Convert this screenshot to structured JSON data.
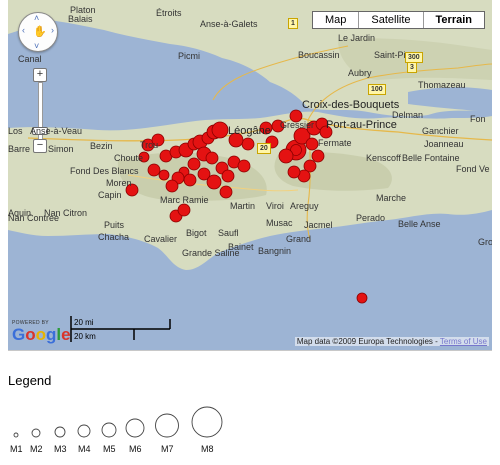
{
  "map": {
    "map_types": [
      {
        "label": "Map",
        "active": false
      },
      {
        "label": "Satellite",
        "active": false
      },
      {
        "label": "Terrain",
        "active": true
      }
    ],
    "controls": {
      "zoom_in": "+",
      "zoom_out": "−",
      "pan_arrows": [
        "‹",
        "›",
        "˄",
        "˅"
      ],
      "pan_hand": "✋"
    },
    "places": [
      {
        "name": "Platon",
        "key": "p1"
      },
      {
        "name": "Balais",
        "key": "p2"
      },
      {
        "name": "Étroits",
        "key": "p3"
      },
      {
        "name": "Anse-à-Galets",
        "key": "p4"
      },
      {
        "name": "Le Jardin",
        "key": "p5"
      },
      {
        "name": "Boucassin",
        "key": "p6"
      },
      {
        "name": "Saint-Pierre",
        "key": "p7"
      },
      {
        "name": "Picmi",
        "key": "p8"
      },
      {
        "name": "Aubry",
        "key": "p9"
      },
      {
        "name": "Thomazeau",
        "key": "p10"
      },
      {
        "name": "Canal",
        "key": "p11"
      },
      {
        "name": "Croix-des-Bouquets",
        "key": "p12"
      },
      {
        "name": "Delman",
        "key": "p13"
      },
      {
        "name": "Léogâne",
        "key": "p14"
      },
      {
        "name": "Gressier",
        "key": "p15"
      },
      {
        "name": "Port-au-Prince",
        "key": "p16"
      },
      {
        "name": "Ganchier",
        "key": "p17"
      },
      {
        "name": "Fon",
        "key": "p18"
      },
      {
        "name": "Los",
        "key": "p19"
      },
      {
        "name": "Anse-à-Veau",
        "key": "p20"
      },
      {
        "name": "Barre",
        "key": "p21"
      },
      {
        "name": "Simon",
        "key": "p22"
      },
      {
        "name": "Bezin",
        "key": "p23"
      },
      {
        "name": "Trou",
        "key": "p24"
      },
      {
        "name": "Fermate",
        "key": "p25"
      },
      {
        "name": "Joanneau",
        "key": "p26"
      },
      {
        "name": "Choute",
        "key": "p27"
      },
      {
        "name": "Kenscoff",
        "key": "p28"
      },
      {
        "name": "Belle Fontaine",
        "key": "p29"
      },
      {
        "name": "Fond Ve",
        "key": "p30"
      },
      {
        "name": "Fond Des Blancs",
        "key": "p31"
      },
      {
        "name": "Moren",
        "key": "p32"
      },
      {
        "name": "Capin",
        "key": "p33"
      },
      {
        "name": "Nan Contree",
        "key": "p34"
      },
      {
        "name": "Marche",
        "key": "p35"
      },
      {
        "name": "Martin",
        "key": "p36"
      },
      {
        "name": "Viroi",
        "key": "p37"
      },
      {
        "name": "Areguy",
        "key": "p38"
      },
      {
        "name": "Aquin",
        "key": "p39"
      },
      {
        "name": "Nan Citron",
        "key": "p40"
      },
      {
        "name": "Marc Ramie",
        "key": "p41"
      },
      {
        "name": "Puits",
        "key": "p42"
      },
      {
        "name": "Chacha",
        "key": "p43"
      },
      {
        "name": "Cavalier",
        "key": "p44"
      },
      {
        "name": "Bigot",
        "key": "p45"
      },
      {
        "name": "Saufl",
        "key": "p46"
      },
      {
        "name": "Musac",
        "key": "p47"
      },
      {
        "name": "Jacmel",
        "key": "p48"
      },
      {
        "name": "Perado",
        "key": "p49"
      },
      {
        "name": "Belle Anse",
        "key": "p50"
      },
      {
        "name": "Grand",
        "key": "p51"
      },
      {
        "name": "Gros",
        "key": "p52"
      },
      {
        "name": "Bainet",
        "key": "p53"
      },
      {
        "name": "Bangnin",
        "key": "p54"
      },
      {
        "name": "Grande Saline",
        "key": "p55"
      }
    ],
    "road_shields": [
      "1",
      "300",
      "3",
      "100",
      "20"
    ],
    "scale": {
      "top": "20 mi",
      "bottom": "20 km"
    },
    "badge": {
      "powered": "POWERED BY",
      "logo": "Google"
    },
    "copyright": {
      "text": "Map data ©2009 Europa Technologies - ",
      "terms": "Terms of Use"
    },
    "colors": {
      "sea": "#9db4d4",
      "land": "#d7dcc0",
      "marker": "#e41212"
    },
    "quake_markers": [
      {
        "magnitude": 5.0
      },
      {
        "magnitude": 5.0
      },
      {
        "magnitude": 5.0
      },
      {
        "magnitude": 4.5
      },
      {
        "magnitude": 5.0
      },
      {
        "magnitude": 4.5
      },
      {
        "magnitude": 5.0
      },
      {
        "magnitude": 5.5
      },
      {
        "magnitude": 5.0
      },
      {
        "magnitude": 5.5
      },
      {
        "magnitude": 5.0
      },
      {
        "magnitude": 5.5
      },
      {
        "magnitude": 6.0
      },
      {
        "magnitude": 5.5
      },
      {
        "magnitude": 5.0
      },
      {
        "magnitude": 5.0
      },
      {
        "magnitude": 4.5
      },
      {
        "magnitude": 5.0
      },
      {
        "magnitude": 5.0
      },
      {
        "magnitude": 5.0
      },
      {
        "magnitude": 5.0
      },
      {
        "magnitude": 5.5
      },
      {
        "magnitude": 5.0
      },
      {
        "magnitude": 5.0
      },
      {
        "magnitude": 5.0
      },
      {
        "magnitude": 5.0
      },
      {
        "magnitude": 5.0
      },
      {
        "magnitude": 7.0
      },
      {
        "magnitude": 6.0
      },
      {
        "magnitude": 5.0
      },
      {
        "magnitude": 5.5
      },
      {
        "magnitude": 5.0
      },
      {
        "magnitude": 5.0
      },
      {
        "magnitude": 5.0
      },
      {
        "magnitude": 5.0
      },
      {
        "magnitude": 5.0
      },
      {
        "magnitude": 5.5
      },
      {
        "magnitude": 5.0
      },
      {
        "magnitude": 5.0
      },
      {
        "magnitude": 5.0
      },
      {
        "magnitude": 5.0
      },
      {
        "magnitude": 5.0
      },
      {
        "magnitude": 5.5
      },
      {
        "magnitude": 5.0
      },
      {
        "magnitude": 5.0
      },
      {
        "magnitude": 5.0
      },
      {
        "magnitude": 5.0
      },
      {
        "magnitude": 4.5
      }
    ]
  },
  "legend": {
    "title": "Legend",
    "items": [
      "M1",
      "M2",
      "M3",
      "M4",
      "M5",
      "M6",
      "M7",
      "M8"
    ]
  }
}
